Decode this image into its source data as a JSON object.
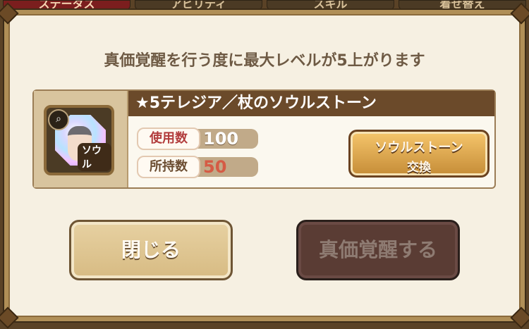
{
  "tabs": [
    {
      "label": "ステータス",
      "active": true
    },
    {
      "label": "アビリティ",
      "active": false
    },
    {
      "label": "スキル",
      "active": false
    },
    {
      "label": "着せ替え",
      "active": false
    }
  ],
  "dialog": {
    "message": "真価覚醒を行う度に最大レベルが5上がります",
    "item": {
      "name": "★5テレジア／杖のソウルストーン",
      "icon_badge": "search-icon",
      "icon_label": "ソウル",
      "used_label": "使用数",
      "used_value": "100",
      "owned_label": "所持数",
      "owned_value": "50",
      "exchange_line1": "ソウルストーン",
      "exchange_line2": "交換"
    },
    "buttons": {
      "close": "閉じる",
      "awaken": "真価覚醒する"
    }
  },
  "colors": {
    "accent_gold": "#c58c37",
    "disabled_button": "#5a3c34",
    "insufficient_value": "#d55b45"
  }
}
